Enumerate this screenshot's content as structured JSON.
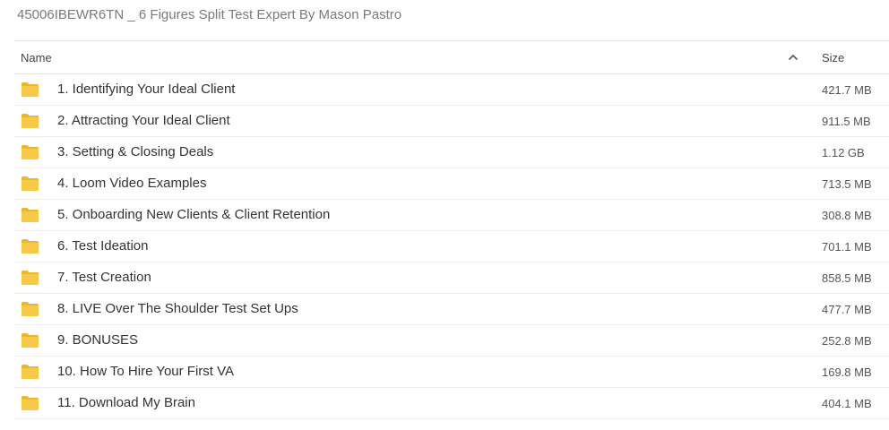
{
  "folder_title": "45006IBEWR6TN _ 6 Figures Split Test Expert By Mason Pastro",
  "header": {
    "name_label": "Name",
    "size_label": "Size",
    "sort_icon": "chevron-up-icon"
  },
  "colors": {
    "folder": "#f7c948",
    "folder_tab": "#eab730",
    "divider": "#e6e6e6"
  },
  "items": [
    {
      "name": "1. Identifying Your Ideal Client",
      "size": "421.7 MB",
      "icon": "folder-icon"
    },
    {
      "name": "2. Attracting Your Ideal Client",
      "size": "911.5 MB",
      "icon": "folder-icon"
    },
    {
      "name": "3. Setting & Closing Deals",
      "size": "1.12 GB",
      "icon": "folder-icon"
    },
    {
      "name": "4. Loom Video Examples",
      "size": "713.5 MB",
      "icon": "folder-icon"
    },
    {
      "name": "5. Onboarding New Clients & Client Retention",
      "size": "308.8 MB",
      "icon": "folder-icon"
    },
    {
      "name": "6. Test Ideation",
      "size": "701.1 MB",
      "icon": "folder-icon"
    },
    {
      "name": "7. Test Creation",
      "size": "858.5 MB",
      "icon": "folder-icon"
    },
    {
      "name": "8. LIVE Over The Shoulder Test Set Ups",
      "size": "477.7 MB",
      "icon": "folder-icon"
    },
    {
      "name": "9. BONUSES",
      "size": "252.8 MB",
      "icon": "folder-icon"
    },
    {
      "name": "10. How To Hire Your First VA",
      "size": "169.8 MB",
      "icon": "folder-icon"
    },
    {
      "name": "11. Download My Brain",
      "size": "404.1 MB",
      "icon": "folder-icon"
    }
  ]
}
